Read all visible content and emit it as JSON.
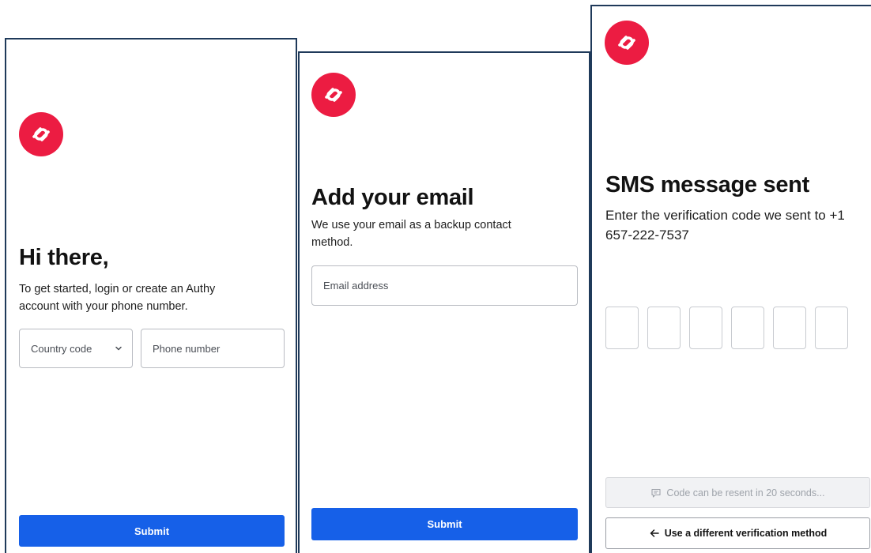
{
  "colors": {
    "brand": "#ec1c42",
    "primary_button": "#1660e8",
    "panel_border": "#1f3a5a"
  },
  "screen_signup": {
    "heading": "Hi there,",
    "description": "To get started, login or create an Authy account with your phone number.",
    "country_code_placeholder": "Country code",
    "phone_placeholder": "Phone number",
    "submit_label": "Submit",
    "logo_icon": "authy-logo-icon",
    "dropdown_icon": "chevron-down-icon"
  },
  "screen_email": {
    "heading": "Add your email",
    "description": "We use your email as a backup contact method.",
    "email_placeholder": "Email address",
    "submit_label": "Submit",
    "logo_icon": "authy-logo-icon"
  },
  "screen_sms": {
    "heading": "SMS message sent",
    "description": "Enter the verification code we sent to +1 657-222-7537",
    "code_length": 6,
    "resend_label": "Code can be resent in 20 seconds...",
    "resend_icon": "message-icon",
    "alt_method_label": "Use a different verification method",
    "alt_method_icon": "arrow-left-icon",
    "logo_icon": "authy-logo-icon"
  }
}
